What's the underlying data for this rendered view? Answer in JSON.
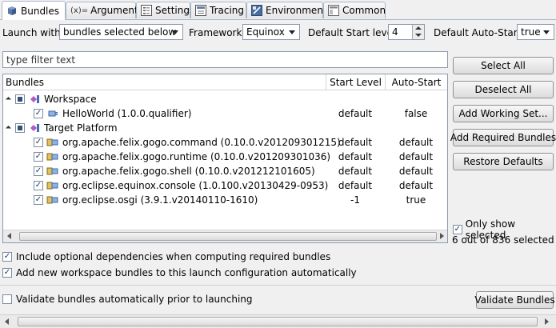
{
  "tabs": [
    {
      "label": "Bundles",
      "icon": "bundles-icon",
      "active": true
    },
    {
      "label": "Arguments",
      "icon": "arguments-icon"
    },
    {
      "label": "Settings",
      "icon": "settings-icon"
    },
    {
      "label": "Tracing",
      "icon": "tracing-icon"
    },
    {
      "label": "Environment",
      "icon": "environment-icon"
    },
    {
      "label": "Common",
      "icon": "common-icon"
    }
  ],
  "arguments_icon_text": "(x)=",
  "toolbar": {
    "launch_with_label": "Launch with:",
    "launch_with_value": "bundles selected below",
    "framework_label": "Framework:",
    "framework_value": "Equinox",
    "start_level_label": "Default Start level:",
    "start_level_value": "4",
    "auto_start_label": "Default Auto-Start:",
    "auto_start_value": "true"
  },
  "filter": {
    "value": "type filter text"
  },
  "tree": {
    "columns": [
      "Bundles",
      "Start Level",
      "Auto-Start"
    ],
    "groups": [
      {
        "label": "Workspace",
        "items": [
          {
            "name": "HelloWorld (1.0.0.qualifier)",
            "start_level": "default",
            "auto_start": "false"
          }
        ]
      },
      {
        "label": "Target Platform",
        "items": [
          {
            "name": "org.apache.felix.gogo.command (0.10.0.v201209301215)",
            "start_level": "default",
            "auto_start": "default"
          },
          {
            "name": "org.apache.felix.gogo.runtime (0.10.0.v201209301036)",
            "start_level": "default",
            "auto_start": "default"
          },
          {
            "name": "org.apache.felix.gogo.shell (0.10.0.v201212101605)",
            "start_level": "default",
            "auto_start": "default"
          },
          {
            "name": "org.eclipse.equinox.console (1.0.100.v20130429-0953)",
            "start_level": "default",
            "auto_start": "default"
          },
          {
            "name": "org.eclipse.osgi (3.9.1.v20140110-1610)",
            "start_level": "-1",
            "auto_start": "true"
          }
        ]
      }
    ]
  },
  "side_buttons": {
    "select_all": "Select All",
    "deselect_all": "Deselect All",
    "add_working_set": "Add Working Set...",
    "add_required": "Add Required Bundles",
    "restore_defaults": "Restore Defaults"
  },
  "only_show_selected": "Only show selected",
  "selected_count": "6 out of 836 selected",
  "options": {
    "include_optional": "Include optional dependencies when computing required bundles",
    "add_new_workspace": "Add new workspace bundles to this launch configuration automatically",
    "validate_auto": "Validate bundles automatically prior to launching"
  },
  "validate_button": "Validate Bundles",
  "colors": {
    "accent": "#2e4f7e",
    "border": "#8d9aae"
  }
}
